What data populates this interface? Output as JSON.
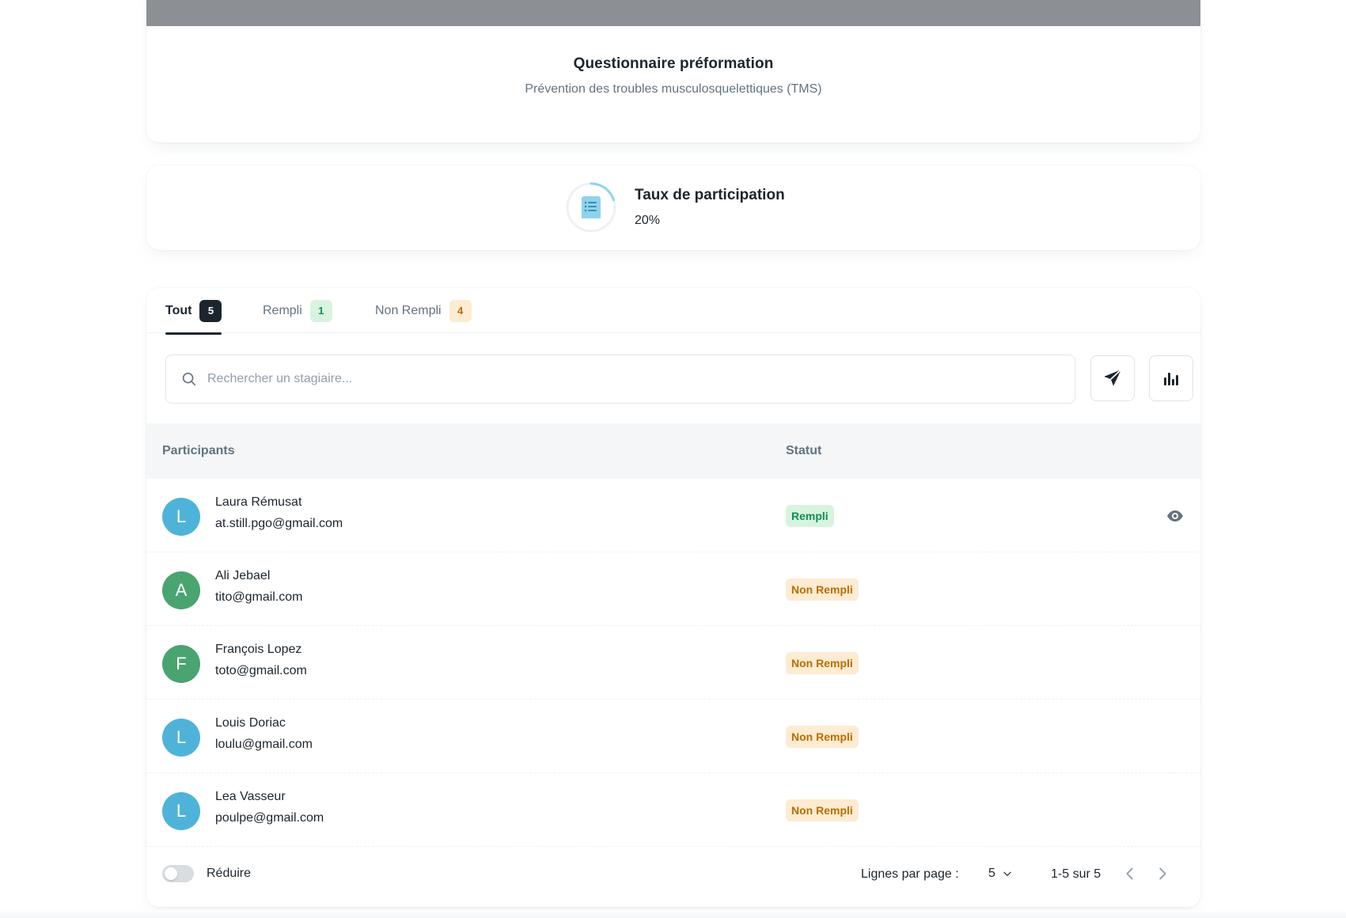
{
  "header": {
    "title": "Questionnaire préformation",
    "subtitle": "Prévention des troubles musculosquelettiques (TMS)"
  },
  "participation": {
    "title": "Taux de participation",
    "value_label": "20%",
    "fraction": 0.2,
    "icon": "document-list-icon"
  },
  "tabs": [
    {
      "label": "Tout",
      "count": "5",
      "active": true
    },
    {
      "label": "Rempli",
      "count": "1"
    },
    {
      "label": "Non Rempli",
      "count": "4"
    }
  ],
  "search": {
    "placeholder": "Rechercher un stagiaire..."
  },
  "toolbar": {
    "send_icon": "send-icon",
    "stats_icon": "bar-chart-icon"
  },
  "table": {
    "columns": {
      "participants": "Participants",
      "status": "Statut"
    },
    "rows": [
      {
        "initial": "L",
        "name": "Laura Rémusat",
        "email": "at.still.pgo@gmail.com",
        "status": "Rempli",
        "avatar_color": "#4fb3d9"
      },
      {
        "initial": "A",
        "name": "Ali Jebael",
        "email": "tito@gmail.com",
        "status": "Non Rempli",
        "avatar_color": "#4aa470"
      },
      {
        "initial": "F",
        "name": "François Lopez",
        "email": "toto@gmail.com",
        "status": "Non Rempli",
        "avatar_color": "#4aa470"
      },
      {
        "initial": "L",
        "name": "Louis Doriac",
        "email": "loulu@gmail.com",
        "status": "Non Rempli",
        "avatar_color": "#4fb3d9"
      },
      {
        "initial": "L",
        "name": "Lea Vasseur",
        "email": "poulpe@gmail.com",
        "status": "Non Rempli",
        "avatar_color": "#4fb3d9"
      }
    ]
  },
  "footer": {
    "toggle_label": "Réduire",
    "rows_per_page_label": "Lignes par page :",
    "rows_per_page_value": "5",
    "range": "1-5 sur 5"
  },
  "colors": {
    "accent_dark": "#1c252e",
    "filled_bg": "#d8f3df",
    "filled_text": "#118d57",
    "unfilled_bg": "#fdebd2",
    "unfilled_text": "#b76e00",
    "ring": "#8fd3ea"
  }
}
